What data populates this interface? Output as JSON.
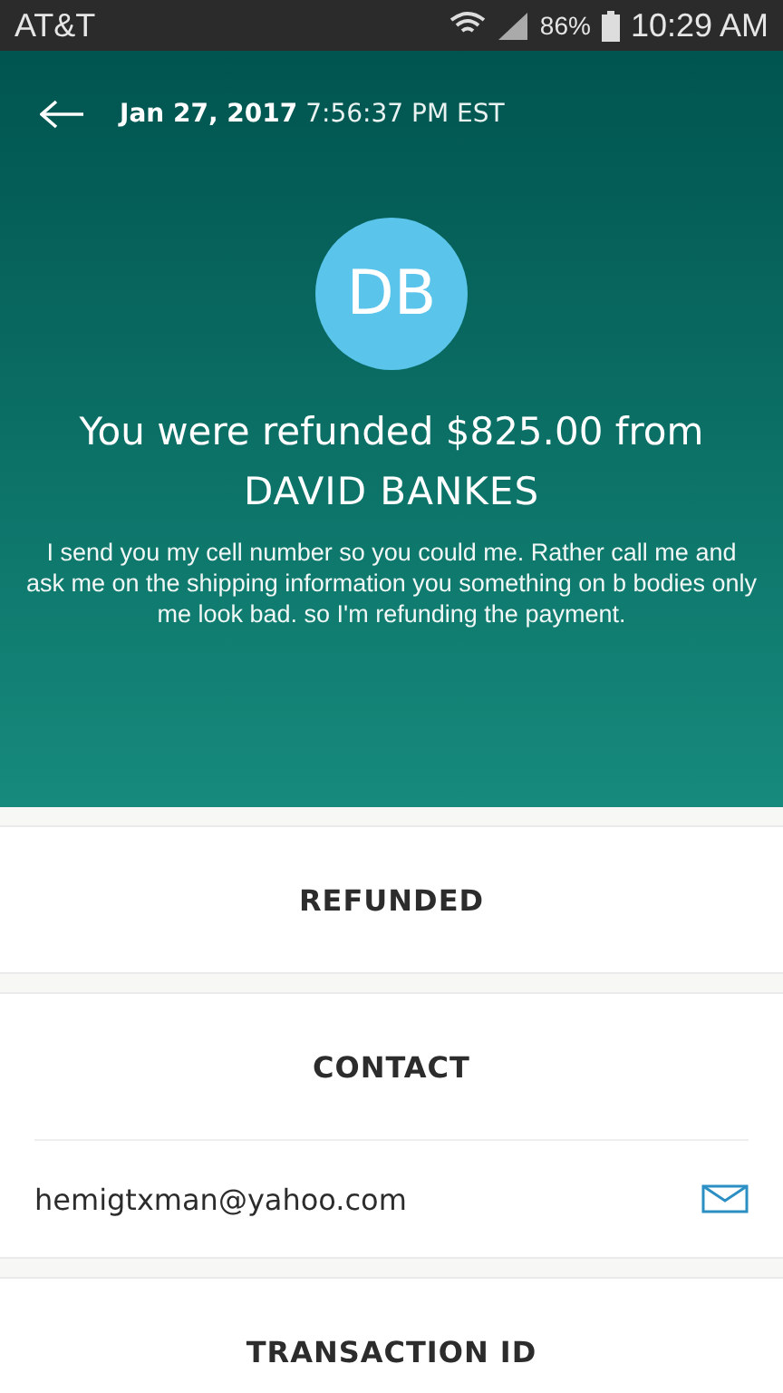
{
  "status_bar": {
    "carrier": "AT&T",
    "battery": "86%",
    "time": "10:29 AM"
  },
  "header": {
    "date_time": "**Jan 27, 2017** 7:56:37 PM EST",
    "avatar_initials": "DB",
    "title": "You were refunded $825.00 from",
    "name": "DAVID BANKES",
    "message": "I send you my cell number so you could me. Rather call me and ask me on the shipping information you something on b bodies only me look bad. so I'm refunding the payment."
  },
  "sections": [
    {
      "kind": "heading",
      "title": "REFUNDED"
    },
    {
      "kind": "contact",
      "title": "CONTACT",
      "email": "hemigtxman@yahoo.com"
    },
    {
      "kind": "heading",
      "title": "TRANSACTION ID"
    }
  ]
}
